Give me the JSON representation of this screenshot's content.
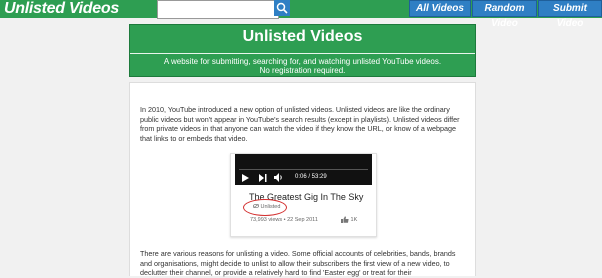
{
  "header": {
    "logo": "Unlisted Videos",
    "search_placeholder": "",
    "nav": [
      "All Videos",
      "Random Video",
      "Submit Video"
    ]
  },
  "hero": {
    "title": "Unlisted Videos",
    "subtitle_line1": "A website for submitting, searching for, and watching unlisted YouTube videos.",
    "subtitle_line2": "No registration required."
  },
  "content": {
    "para1": "In 2010, YouTube introduced a new option of unlisted videos. Unlisted videos are like the ordinary public videos but won't appear in YouTube's search results (except in playlists). Unlisted videos differ from private videos in that anyone can watch the video if they know the URL, or know of a webpage that links to or embeds that video.",
    "para2": "There are various reasons for unlisting a video. Some official accounts of celebrities, bands, brands and organisations, might decide to unlist to allow their subscribers the first view of a new video, to declutter their channel, or provide a relatively hard to find 'Easter egg' or treat for their"
  },
  "video_card": {
    "time": "0:06 / 53:29",
    "title": "The Greatest Gig In The Sky",
    "badge": "Unlisted",
    "meta": "73,993 views • 22 Sep 2011",
    "likes": "1K"
  },
  "colors": {
    "green": "#2e9e52",
    "blue": "#2f7fc4",
    "highlight": "#d32f2f"
  }
}
